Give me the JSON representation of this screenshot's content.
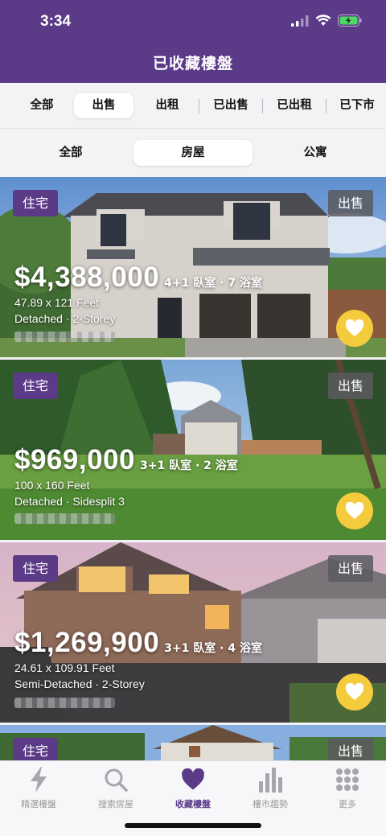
{
  "status": {
    "time": "3:34"
  },
  "header": {
    "title": "已收藏樓盤"
  },
  "filters": [
    "全部",
    "出售",
    "出租",
    "已出售",
    "已出租",
    "已下市"
  ],
  "property_types": [
    "全部",
    "房屋",
    "公寓"
  ],
  "listings": [
    {
      "type": "住宅",
      "status": "出售",
      "price": "$4,388,000",
      "rooms": "4+1 臥室 · 7 浴室",
      "lot": "47.89 x 121 Feet",
      "style": "Detached · 2-Storey"
    },
    {
      "type": "住宅",
      "status": "出售",
      "price": "$969,000",
      "rooms": "3+1 臥室 · 2 浴室",
      "lot": "100 x 160 Feet",
      "style": "Detached · Sidesplit 3"
    },
    {
      "type": "住宅",
      "status": "出售",
      "price": "$1,269,900",
      "rooms": "3+1 臥室 · 4 浴室",
      "lot": "24.61 x 109.91 Feet",
      "style": "Semi-Detached · 2-Storey"
    },
    {
      "type": "住宅",
      "status": "出售"
    }
  ],
  "nav": [
    {
      "label": "精選樓盤",
      "icon": "lightning-icon"
    },
    {
      "label": "搜索房屋",
      "icon": "search-icon"
    },
    {
      "label": "收藏樓盤",
      "icon": "heart-icon"
    },
    {
      "label": "樓市趨勢",
      "icon": "bar-chart-icon"
    },
    {
      "label": "更多",
      "icon": "grid-dots-icon"
    }
  ],
  "colors": {
    "brand": "#5b3a88",
    "favorite": "#f5cb3e"
  }
}
